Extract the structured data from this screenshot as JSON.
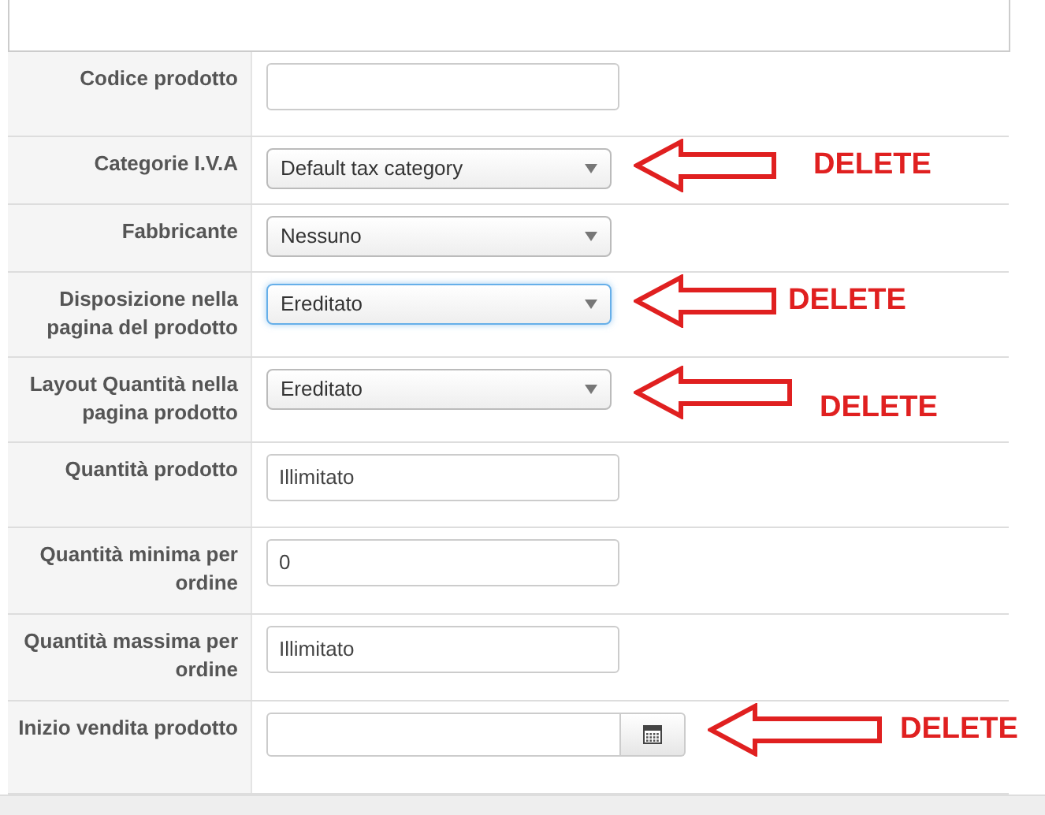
{
  "fields": [
    {
      "label": "Codice prodotto",
      "kind": "text"
    },
    {
      "label": "Categorie I.V.A",
      "kind": "select",
      "value": "Default tax category",
      "focused": false,
      "annotation": "DELETE"
    },
    {
      "label": "Fabbricante",
      "kind": "select",
      "value": "Nessuno",
      "focused": false
    },
    {
      "label": "Disposizione nella pagina del prodotto",
      "kind": "select",
      "value": "Ereditato",
      "focused": true,
      "annotation": "DELETE"
    },
    {
      "label": "Layout Quantità nella pagina prodotto",
      "kind": "select",
      "value": "Ereditato",
      "focused": false,
      "annotation": "DELETE"
    },
    {
      "label": "Quantità prodotto",
      "kind": "text",
      "value": "Illimitato"
    },
    {
      "label": "Quantità minima per ordine",
      "kind": "text",
      "value": "0"
    },
    {
      "label": "Quantità massima per ordine",
      "kind": "text",
      "value": "Illimitato"
    },
    {
      "label": "Inizio vendita prodotto",
      "kind": "date",
      "annotation": "DELETE"
    }
  ]
}
